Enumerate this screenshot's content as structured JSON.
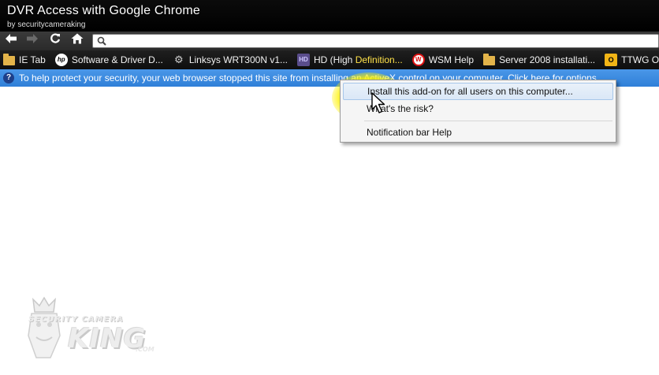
{
  "video": {
    "title": "DVR Access with Google Chrome",
    "author": "by securitycameraking"
  },
  "toolbar": {
    "back_icon": "back-arrow-icon",
    "forward_icon": "forward-arrow-icon",
    "reload_icon": "reload-icon",
    "home_icon": "home-icon",
    "omnibox_value": ""
  },
  "bookmarks": [
    {
      "icon": "folder-icon",
      "label": "IE Tab"
    },
    {
      "icon": "hp-icon",
      "label": "Software & Driver D..."
    },
    {
      "icon": "linksys-icon",
      "label": "Linksys WRT300N v1..."
    },
    {
      "icon": "hd-icon",
      "label_prefix": "HD (High ",
      "label_highlight": "Definition..."
    },
    {
      "icon": "wsm-icon",
      "label": "WSM Help"
    },
    {
      "icon": "folder-icon",
      "label": "Server 2008 installati..."
    },
    {
      "icon": "ttwg-icon",
      "label": "TTWG OW"
    }
  ],
  "infobar": {
    "text": "To help protect your security, your web browser stopped this site from installing an ActiveX control on your computer. Click here for options..."
  },
  "context_menu": {
    "items": [
      {
        "label": "Install this add-on for all users on this computer..."
      },
      {
        "label": "What's the risk?"
      },
      {
        "label": "Notification bar Help"
      }
    ]
  },
  "watermark": {
    "top_text": "SECURITY CAMERA",
    "main_text": "KING",
    "sub_text": ".COM"
  },
  "colors": {
    "infobar": "#3a8ae0",
    "highlight": "#fff200",
    "bookmarks_bar": "#141414"
  }
}
